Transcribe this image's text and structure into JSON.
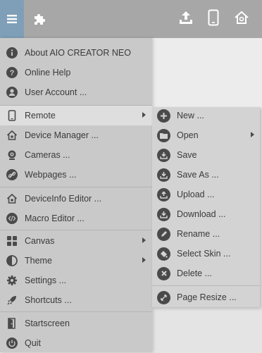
{
  "main_menu": {
    "items": [
      {
        "label": "About AIO CREATOR NEO",
        "icon": "info-icon"
      },
      {
        "label": "Online Help",
        "icon": "question-icon"
      },
      {
        "label": "User Account ...",
        "icon": "user-icon"
      },
      {
        "label": "Remote",
        "icon": "phone-icon",
        "has_submenu": true,
        "active": true
      },
      {
        "label": "Device Manager ...",
        "icon": "home-gear-icon"
      },
      {
        "label": "Cameras ...",
        "icon": "camera-icon"
      },
      {
        "label": "Webpages ...",
        "icon": "link-icon"
      },
      {
        "label": "DeviceInfo Editor ...",
        "icon": "home-gear-icon"
      },
      {
        "label": "Macro Editor ...",
        "icon": "code-icon"
      },
      {
        "label": "Canvas",
        "icon": "grid-icon",
        "has_submenu": true
      },
      {
        "label": "Theme",
        "icon": "contrast-icon",
        "has_submenu": true
      },
      {
        "label": "Settings ...",
        "icon": "gear-icon"
      },
      {
        "label": "Shortcuts ...",
        "icon": "rocket-icon"
      },
      {
        "label": "Startscreen",
        "icon": "door-icon"
      },
      {
        "label": "Quit",
        "icon": "power-icon"
      }
    ]
  },
  "remote_submenu": {
    "items": [
      {
        "label": "New ...",
        "icon": "plus-circle-icon"
      },
      {
        "label": "Open",
        "icon": "folder-icon",
        "has_submenu": true
      },
      {
        "label": "Save",
        "icon": "save-icon"
      },
      {
        "label": "Save As ...",
        "icon": "save-as-icon"
      },
      {
        "label": "Upload ...",
        "icon": "upload-icon"
      },
      {
        "label": "Download ...",
        "icon": "download-icon"
      },
      {
        "label": "Rename ...",
        "icon": "pencil-icon"
      },
      {
        "label": "Select Skin ...",
        "icon": "paint-icon"
      },
      {
        "label": "Delete ...",
        "icon": "close-icon"
      },
      {
        "label": "Page Resize ...",
        "icon": "resize-icon"
      }
    ]
  },
  "toolbar": {
    "icons": [
      "menu-icon",
      "puzzle-icon",
      "upload-tray-icon",
      "phone-outline-icon",
      "home-remote-icon"
    ]
  },
  "colors": {
    "accent": "#7f9fb8",
    "topbar": "#a7a7a7",
    "menu_bg": "#c9c9c9",
    "submenu_bg": "#d3d3d3"
  }
}
